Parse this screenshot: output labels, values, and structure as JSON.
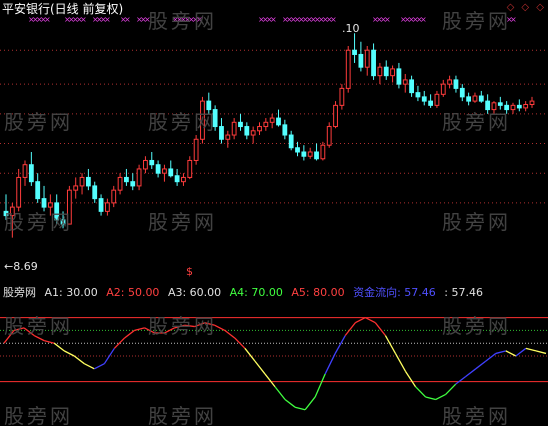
{
  "header": {
    "title": "平安银行(日线 前复权)",
    "hi_label": ".10",
    "lo_label": "←8.69",
    "arrow_label": "$",
    "controls": "◇ ◇ ◇"
  },
  "watermark": "股旁网",
  "indicator_legend": {
    "name": "股旁网",
    "items": [
      {
        "text": "A1: 30.00",
        "color": "#e0e0e0"
      },
      {
        "text": "A2: 50.00",
        "color": "#ff4040"
      },
      {
        "text": "A3: 60.00",
        "color": "#e0e0e0"
      },
      {
        "text": "A4: 70.00",
        "color": "#40ff40"
      },
      {
        "text": "A5: 80.00",
        "color": "#ff4040"
      },
      {
        "text": "资金流向: 57.46",
        "color": "#5050ff"
      },
      {
        "text": ": 57.46",
        "color": "#e0e0e0"
      }
    ]
  },
  "colors": {
    "up": "#ff3c3c",
    "down": "#54ffff",
    "grid": "#b03030",
    "marker": "#e040e0",
    "flow_red": "#ff3030",
    "flow_yellow": "#ffff60",
    "flow_blue": "#4040ff",
    "flow_green": "#40ff40"
  },
  "chart_data": [
    {
      "type": "candlestick",
      "title": "平安银行(日线 前复权)",
      "price_range": [
        8.45,
        11.28
      ],
      "marked_high": 11.1,
      "marked_low": 8.69,
      "gridlines": [
        10.9,
        10.5,
        10.15,
        9.8,
        9.45,
        9.1
      ],
      "candles": [
        [
          9.0,
          9.2,
          8.9,
          8.95
        ],
        [
          8.95,
          9.1,
          8.69,
          9.05
        ],
        [
          9.05,
          9.5,
          9.0,
          9.4
        ],
        [
          9.4,
          9.6,
          9.3,
          9.55
        ],
        [
          9.55,
          9.7,
          9.3,
          9.35
        ],
        [
          9.35,
          9.45,
          9.1,
          9.15
        ],
        [
          9.15,
          9.3,
          9.0,
          9.05
        ],
        [
          9.05,
          9.2,
          8.95,
          9.1
        ],
        [
          9.1,
          9.2,
          8.85,
          8.9
        ],
        [
          8.9,
          9.0,
          8.8,
          8.85
        ],
        [
          8.85,
          9.3,
          8.85,
          9.25
        ],
        [
          9.25,
          9.4,
          9.15,
          9.3
        ],
        [
          9.3,
          9.45,
          9.2,
          9.4
        ],
        [
          9.4,
          9.5,
          9.25,
          9.3
        ],
        [
          9.3,
          9.35,
          9.1,
          9.15
        ],
        [
          9.15,
          9.2,
          8.95,
          9.0
        ],
        [
          9.0,
          9.15,
          8.95,
          9.1
        ],
        [
          9.1,
          9.3,
          9.05,
          9.25
        ],
        [
          9.25,
          9.45,
          9.2,
          9.4
        ],
        [
          9.4,
          9.5,
          9.3,
          9.35
        ],
        [
          9.35,
          9.45,
          9.25,
          9.3
        ],
        [
          9.3,
          9.55,
          9.25,
          9.5
        ],
        [
          9.5,
          9.65,
          9.45,
          9.6
        ],
        [
          9.6,
          9.7,
          9.5,
          9.55
        ],
        [
          9.55,
          9.6,
          9.4,
          9.45
        ],
        [
          9.45,
          9.55,
          9.35,
          9.5
        ],
        [
          9.5,
          9.6,
          9.4,
          9.42
        ],
        [
          9.42,
          9.5,
          9.3,
          9.35
        ],
        [
          9.35,
          9.45,
          9.3,
          9.4
        ],
        [
          9.4,
          9.65,
          9.38,
          9.6
        ],
        [
          9.6,
          9.9,
          9.55,
          9.85
        ],
        [
          9.85,
          10.35,
          9.8,
          10.3
        ],
        [
          10.3,
          10.4,
          10.15,
          10.2
        ],
        [
          10.2,
          10.25,
          9.95,
          10.0
        ],
        [
          10.0,
          10.1,
          9.8,
          9.85
        ],
        [
          9.85,
          9.95,
          9.75,
          9.9
        ],
        [
          9.9,
          10.1,
          9.85,
          10.05
        ],
        [
          10.05,
          10.15,
          9.95,
          10.0
        ],
        [
          10.0,
          10.05,
          9.85,
          9.9
        ],
        [
          9.9,
          10.0,
          9.8,
          9.95
        ],
        [
          9.95,
          10.05,
          9.9,
          10.0
        ],
        [
          10.0,
          10.1,
          9.95,
          10.05
        ],
        [
          10.05,
          10.15,
          9.98,
          10.1
        ],
        [
          10.1,
          10.2,
          10.0,
          10.02
        ],
        [
          10.02,
          10.08,
          9.85,
          9.9
        ],
        [
          9.9,
          9.95,
          9.72,
          9.75
        ],
        [
          9.75,
          9.82,
          9.65,
          9.7
        ],
        [
          9.7,
          9.78,
          9.6,
          9.65
        ],
        [
          9.65,
          9.75,
          9.62,
          9.7
        ],
        [
          9.7,
          9.8,
          9.6,
          9.62
        ],
        [
          9.62,
          9.82,
          9.6,
          9.78
        ],
        [
          9.78,
          10.05,
          9.75,
          10.0
        ],
        [
          10.0,
          10.3,
          9.98,
          10.25
        ],
        [
          10.25,
          10.5,
          10.2,
          10.45
        ],
        [
          10.45,
          10.95,
          10.4,
          10.9
        ],
        [
          10.9,
          11.1,
          10.75,
          10.85
        ],
        [
          10.85,
          11.0,
          10.65,
          10.7
        ],
        [
          10.7,
          10.95,
          10.6,
          10.9
        ],
        [
          10.9,
          10.98,
          10.55,
          10.6
        ],
        [
          10.6,
          10.75,
          10.5,
          10.7
        ],
        [
          10.7,
          10.78,
          10.55,
          10.6
        ],
        [
          10.6,
          10.72,
          10.52,
          10.68
        ],
        [
          10.68,
          10.75,
          10.45,
          10.5
        ],
        [
          10.5,
          10.62,
          10.4,
          10.55
        ],
        [
          10.55,
          10.6,
          10.35,
          10.4
        ],
        [
          10.4,
          10.48,
          10.3,
          10.35
        ],
        [
          10.35,
          10.42,
          10.25,
          10.3
        ],
        [
          10.3,
          10.38,
          10.22,
          10.25
        ],
        [
          10.25,
          10.42,
          10.22,
          10.38
        ],
        [
          10.38,
          10.55,
          10.35,
          10.5
        ],
        [
          10.5,
          10.6,
          10.45,
          10.55
        ],
        [
          10.55,
          10.6,
          10.4,
          10.45
        ],
        [
          10.45,
          10.5,
          10.3,
          10.35
        ],
        [
          10.35,
          10.4,
          10.25,
          10.3
        ],
        [
          10.3,
          10.4,
          10.28,
          10.36
        ],
        [
          10.36,
          10.42,
          10.28,
          10.3
        ],
        [
          10.3,
          10.38,
          10.15,
          10.2
        ],
        [
          10.2,
          10.3,
          10.15,
          10.28
        ],
        [
          10.28,
          10.35,
          10.2,
          10.25
        ],
        [
          10.25,
          10.3,
          10.15,
          10.2
        ],
        [
          10.2,
          10.28,
          10.15,
          10.25
        ],
        [
          10.25,
          10.32,
          10.18,
          10.22
        ],
        [
          10.22,
          10.3,
          10.18,
          10.26
        ],
        [
          10.26,
          10.35,
          10.22,
          10.3
        ]
      ],
      "top_markers": [
        {
          "from": 28,
          "to": 44
        },
        {
          "from": 64,
          "to": 80
        },
        {
          "from": 92,
          "to": 106
        },
        {
          "from": 120,
          "to": 124
        },
        {
          "from": 136,
          "to": 146
        },
        {
          "from": 172,
          "to": 196
        },
        {
          "from": 258,
          "to": 272
        },
        {
          "from": 282,
          "to": 330
        },
        {
          "from": 372,
          "to": 384
        },
        {
          "from": 400,
          "to": 420
        },
        {
          "from": 506,
          "to": 512
        }
      ]
    },
    {
      "type": "line",
      "title": "股旁网",
      "ylim": [
        0,
        100
      ],
      "reference_lines": [
        {
          "value": 80,
          "color": "#ff3030",
          "style": "solid"
        },
        {
          "value": 70,
          "color": "#30c030",
          "style": "dotted"
        },
        {
          "value": 60,
          "color": "#c0c0c0",
          "style": "dotted"
        },
        {
          "value": 50,
          "color": "#b03030",
          "style": "dotted"
        },
        {
          "value": 30,
          "color": "#ff3030",
          "style": "solid"
        }
      ],
      "series": [
        {
          "name": "资金流向",
          "values": [
            60,
            70,
            72,
            66,
            62,
            60,
            54,
            50,
            44,
            40,
            44,
            56,
            64,
            70,
            72,
            68,
            68,
            72,
            74,
            73,
            76,
            74,
            70,
            64,
            56,
            46,
            36,
            26,
            16,
            10,
            8,
            18,
            36,
            52,
            66,
            76,
            80,
            76,
            66,
            52,
            38,
            26,
            18,
            16,
            20,
            28,
            34,
            40,
            46,
            52,
            54,
            50,
            56,
            54,
            52
          ]
        }
      ]
    }
  ]
}
